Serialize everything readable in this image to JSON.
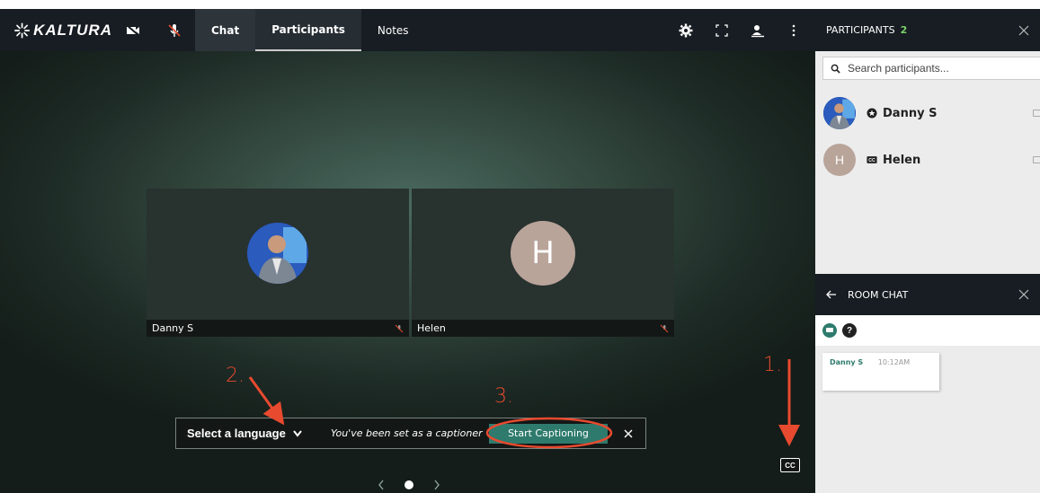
{
  "app": {
    "logo_text": "KALTURA"
  },
  "toolbar": {
    "tabs": [
      {
        "label": "Chat"
      },
      {
        "label": "Participants"
      },
      {
        "label": "Notes"
      }
    ]
  },
  "stage": {
    "tiles": [
      {
        "name": "Danny S"
      },
      {
        "name": "Helen",
        "initial": "H"
      }
    ],
    "caption_bar": {
      "language_label": "Select a language",
      "message": "You've been set as a captioner",
      "start_label": "Start Captioning"
    },
    "cc_label": "CC"
  },
  "annotations": {
    "step1": "1.",
    "step2": "2.",
    "step3": "3.",
    "color": "#e84a2f"
  },
  "participants_panel": {
    "title": "PARTICIPANTS",
    "count": "2",
    "search_placeholder": "Search participants...",
    "list": [
      {
        "name": "Danny S",
        "role": "moderator-icon"
      },
      {
        "name": "Helen",
        "initial": "H",
        "role": "captioner-icon"
      }
    ]
  },
  "chat_panel": {
    "title": "ROOM CHAT",
    "messages": [
      {
        "from": "Danny S",
        "time": "10:12AM"
      }
    ]
  },
  "colors": {
    "accent": "#2e7b6d",
    "count_green": "#7bd16a",
    "topbar": "#171d22"
  }
}
